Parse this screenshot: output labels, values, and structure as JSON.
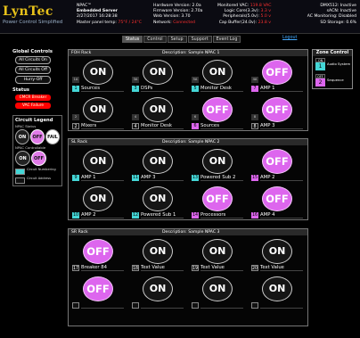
{
  "header": {
    "logo": "LynTec",
    "logo_sub": "Power Control Simplified",
    "device": "NPAC™",
    "device_name": "Embedded Server",
    "datetime": "2/27/2017 16:28:38",
    "temp_label": "Master panel temp:",
    "temp_value": "75°F / 24°C",
    "hw": "Hardware Version: 2.0a",
    "fw": "Firmware Version: 2.70a",
    "web": "Web Version: 3.70",
    "network": "Network:",
    "network_value": "Connected",
    "monitored_label": "Monitored VAC:",
    "monitored_value": "119.8 VAC",
    "logic_label": "Logic Core(3.3v):",
    "logic_value": "3.3 v",
    "periph_label": "Peripherals(5.0v):",
    "periph_value": "5.0 v",
    "cap_label": "Cap Buffer(24.0v):",
    "cap_value": "23.8 v",
    "dmx": "DMX512: Inactive",
    "sacn": "sACN: Inactive",
    "ac_mon": "AC Monitoring: Disabled",
    "sd": "SD Storage: 0.6%"
  },
  "tabs": [
    "Status",
    "Control",
    "Setup",
    "Support",
    "Event Log"
  ],
  "logout": "Logout",
  "global_controls": {
    "title": "Global Controls",
    "buttons": [
      "All Circuits On",
      "All Circuits Off",
      "Hurry-Off"
    ]
  },
  "status": {
    "title": "Status",
    "items": [
      "CMCR Breaker",
      "VAC Failure"
    ]
  },
  "legend": {
    "title": "Circuit Legend",
    "npac_status": "NPAC Status",
    "npac_controllable": "NPAC Controllable",
    "on": "ON",
    "off": "OFF",
    "fail": "FAIL",
    "numbering": "Circuit Numbering",
    "address": "Circuit Address"
  },
  "zone_control": {
    "title": "Zone Control",
    "zones": [
      {
        "tag": "ON",
        "num": "1",
        "label": "Audio System",
        "color": "#44d6d6"
      },
      {
        "tag": "OFF",
        "num": "2",
        "label": "Sequence",
        "color": "#dd66ee"
      }
    ]
  },
  "racks": [
    {
      "name": "FOH Rack",
      "desc_label": "Description:",
      "desc": "Sample NPAC 1",
      "circuits": [
        {
          "state": "ON",
          "badge": "1A",
          "num": "1",
          "name": "Sources",
          "num_style": "cyan"
        },
        {
          "state": "ON",
          "badge": "3A",
          "num": "3",
          "name": "DSPs",
          "num_style": "cyan"
        },
        {
          "state": "ON",
          "badge": "5A",
          "num": "5",
          "name": "Monitor Desk",
          "num_style": "cyan"
        },
        {
          "state": "OFF",
          "badge": "4A",
          "num": "7",
          "name": "AMP 1",
          "num_style": "pink"
        },
        {
          "state": "ON",
          "badge": "2",
          "num": "2",
          "name": "Mixers",
          "num_style": "plain"
        },
        {
          "state": "ON",
          "badge": "4",
          "num": "4",
          "name": "Monitor Desk",
          "num_style": "plain"
        },
        {
          "state": "OFF",
          "badge": "6",
          "num": "6",
          "name": "Sources",
          "num_style": "pink"
        },
        {
          "state": "OFF",
          "badge": "8",
          "num": "8",
          "name": "AMP 3",
          "num_style": "plain"
        }
      ]
    },
    {
      "name": "SL Rack",
      "desc_label": "Description:",
      "desc": "Sample NPAC 2",
      "circuits": [
        {
          "state": "ON",
          "badge": "",
          "num": "9",
          "name": "AMP 1",
          "num_style": "cyan"
        },
        {
          "state": "ON",
          "badge": "",
          "num": "11",
          "name": "AMP 3",
          "num_style": "cyan"
        },
        {
          "state": "ON",
          "badge": "",
          "num": "13",
          "name": "Powered Sub 2",
          "num_style": "cyan"
        },
        {
          "state": "OFF",
          "badge": "",
          "num": "15",
          "name": "AMP 2",
          "num_style": "pink"
        },
        {
          "state": "ON",
          "badge": "",
          "num": "10",
          "name": "AMP 2",
          "num_style": "cyan"
        },
        {
          "state": "ON",
          "badge": "",
          "num": "12",
          "name": "Powered Sub 1",
          "num_style": "cyan"
        },
        {
          "state": "OFF",
          "badge": "",
          "num": "14",
          "name": "Processors",
          "num_style": "pink"
        },
        {
          "state": "OFF",
          "badge": "",
          "num": "16",
          "name": "AMP 4",
          "num_style": "pink"
        }
      ]
    },
    {
      "name": "SR Rack",
      "desc_label": "Description:",
      "desc": "Sample NPAC 3",
      "circuits": [
        {
          "state": "OFF",
          "badge": "",
          "num": "17",
          "name": "Breaker 84",
          "num_style": "plain"
        },
        {
          "state": "ON",
          "badge": "",
          "num": "18",
          "name": "Text Value",
          "num_style": "plain"
        },
        {
          "state": "ON",
          "badge": "",
          "num": "19",
          "name": "Text Value",
          "num_style": "plain"
        },
        {
          "state": "ON",
          "badge": "",
          "num": "20",
          "name": "Text Value",
          "num_style": "plain"
        },
        {
          "state": "OFF",
          "badge": "",
          "num": "",
          "name": "",
          "num_style": "plain"
        },
        {
          "state": "ON",
          "badge": "",
          "num": "",
          "name": "",
          "num_style": "plain"
        },
        {
          "state": "ON",
          "badge": "",
          "num": "",
          "name": "",
          "num_style": "plain"
        },
        {
          "state": "ON",
          "badge": "",
          "num": "",
          "name": "",
          "num_style": "plain"
        }
      ]
    }
  ]
}
